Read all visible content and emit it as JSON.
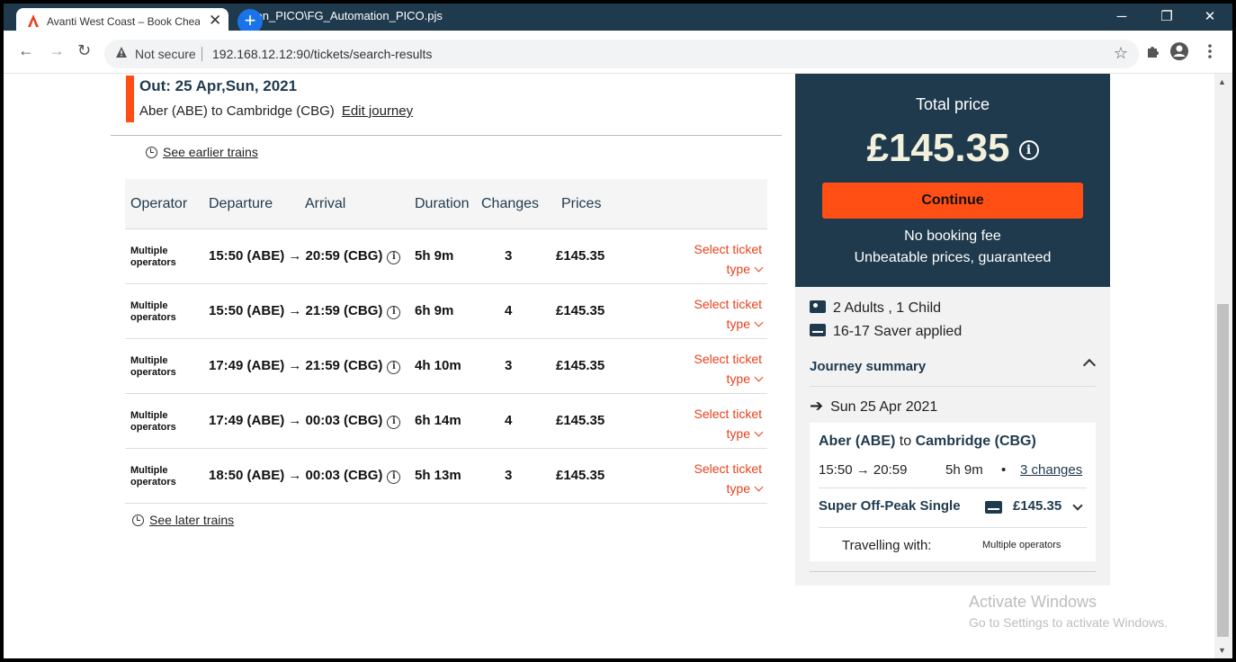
{
  "browser": {
    "tab_title": "Avanti West Coast – Book Cheap",
    "behind_window_title": "tion_PICO\\FG_Automation_PICO.pjs",
    "security_label": "Not secure",
    "url": "192.168.12.12:90/tickets/search-results",
    "new_tab_glyph": "+",
    "close_tab_glyph": "✕",
    "window_controls": {
      "minimize": "─",
      "restore": "❐",
      "close": "✕"
    }
  },
  "journey": {
    "out_title": "Out: 25 Apr,Sun, 2021",
    "route": "Aber (ABE) to Cambridge (CBG)",
    "edit_label": "Edit journey",
    "earlier_label": "See earlier trains",
    "later_label": "See later trains"
  },
  "table": {
    "headers": {
      "operator": "Operator",
      "departure": "Departure",
      "arrival": "Arrival",
      "duration": "Duration",
      "changes": "Changes",
      "prices": "Prices"
    },
    "rows": [
      {
        "operator_line1": "Multiple",
        "operator_line2": "operators",
        "times": "15:50 (ABE) → 20:59 (CBG)",
        "duration": "5h 9m",
        "changes": "3",
        "price": "£145.35",
        "select_line1": "Select ticket",
        "select_line2": "type"
      },
      {
        "operator_line1": "Multiple",
        "operator_line2": "operators",
        "times": "15:50 (ABE) → 21:59 (CBG)",
        "duration": "6h 9m",
        "changes": "4",
        "price": "£145.35",
        "select_line1": "Select ticket",
        "select_line2": "type"
      },
      {
        "operator_line1": "Multiple",
        "operator_line2": "operators",
        "times": "17:49 (ABE) → 21:59 (CBG)",
        "duration": "4h 10m",
        "changes": "3",
        "price": "£145.35",
        "select_line1": "Select ticket",
        "select_line2": "type"
      },
      {
        "operator_line1": "Multiple",
        "operator_line2": "operators",
        "times": "17:49 (ABE) → 00:03 (CBG)",
        "duration": "6h 14m",
        "changes": "4",
        "price": "£145.35",
        "select_line1": "Select ticket",
        "select_line2": "type"
      },
      {
        "operator_line1": "Multiple",
        "operator_line2": "operators",
        "times": "18:50 (ABE) → 00:03 (CBG)",
        "duration": "5h 13m",
        "changes": "3",
        "price": "£145.35",
        "select_line1": "Select ticket",
        "select_line2": "type"
      }
    ],
    "info_glyph": "i"
  },
  "total": {
    "label": "Total price",
    "amount": "£145.35",
    "info_glyph": "i",
    "continue_label": "Continue",
    "no_fee": "No booking fee",
    "guarantee": "Unbeatable prices, guaranteed"
  },
  "summary": {
    "passengers": "2 Adults , 1 Child",
    "railcard": "16-17 Saver applied",
    "title": "Journey summary",
    "date_arrow": "➔",
    "date": "Sun 25 Apr 2021",
    "route_from": "Aber (ABE)",
    "route_to_word": "to",
    "route_to": "Cambridge (CBG)",
    "times": "15:50 → 20:59",
    "duration": "5h 9m",
    "dot": "•",
    "changes_link": "3 changes",
    "fare_name": "Super Off-Peak Single",
    "fare_price": "£145.35",
    "travelling_label": "Travelling with:",
    "operators": "Multiple operators"
  },
  "watermark": {
    "line1": "Activate Windows",
    "line2": "Go to Settings to activate Windows."
  },
  "colors": {
    "brand_dark": "#1f3a4d",
    "brand_orange": "#ff4f14",
    "link_red": "#e8401c"
  }
}
